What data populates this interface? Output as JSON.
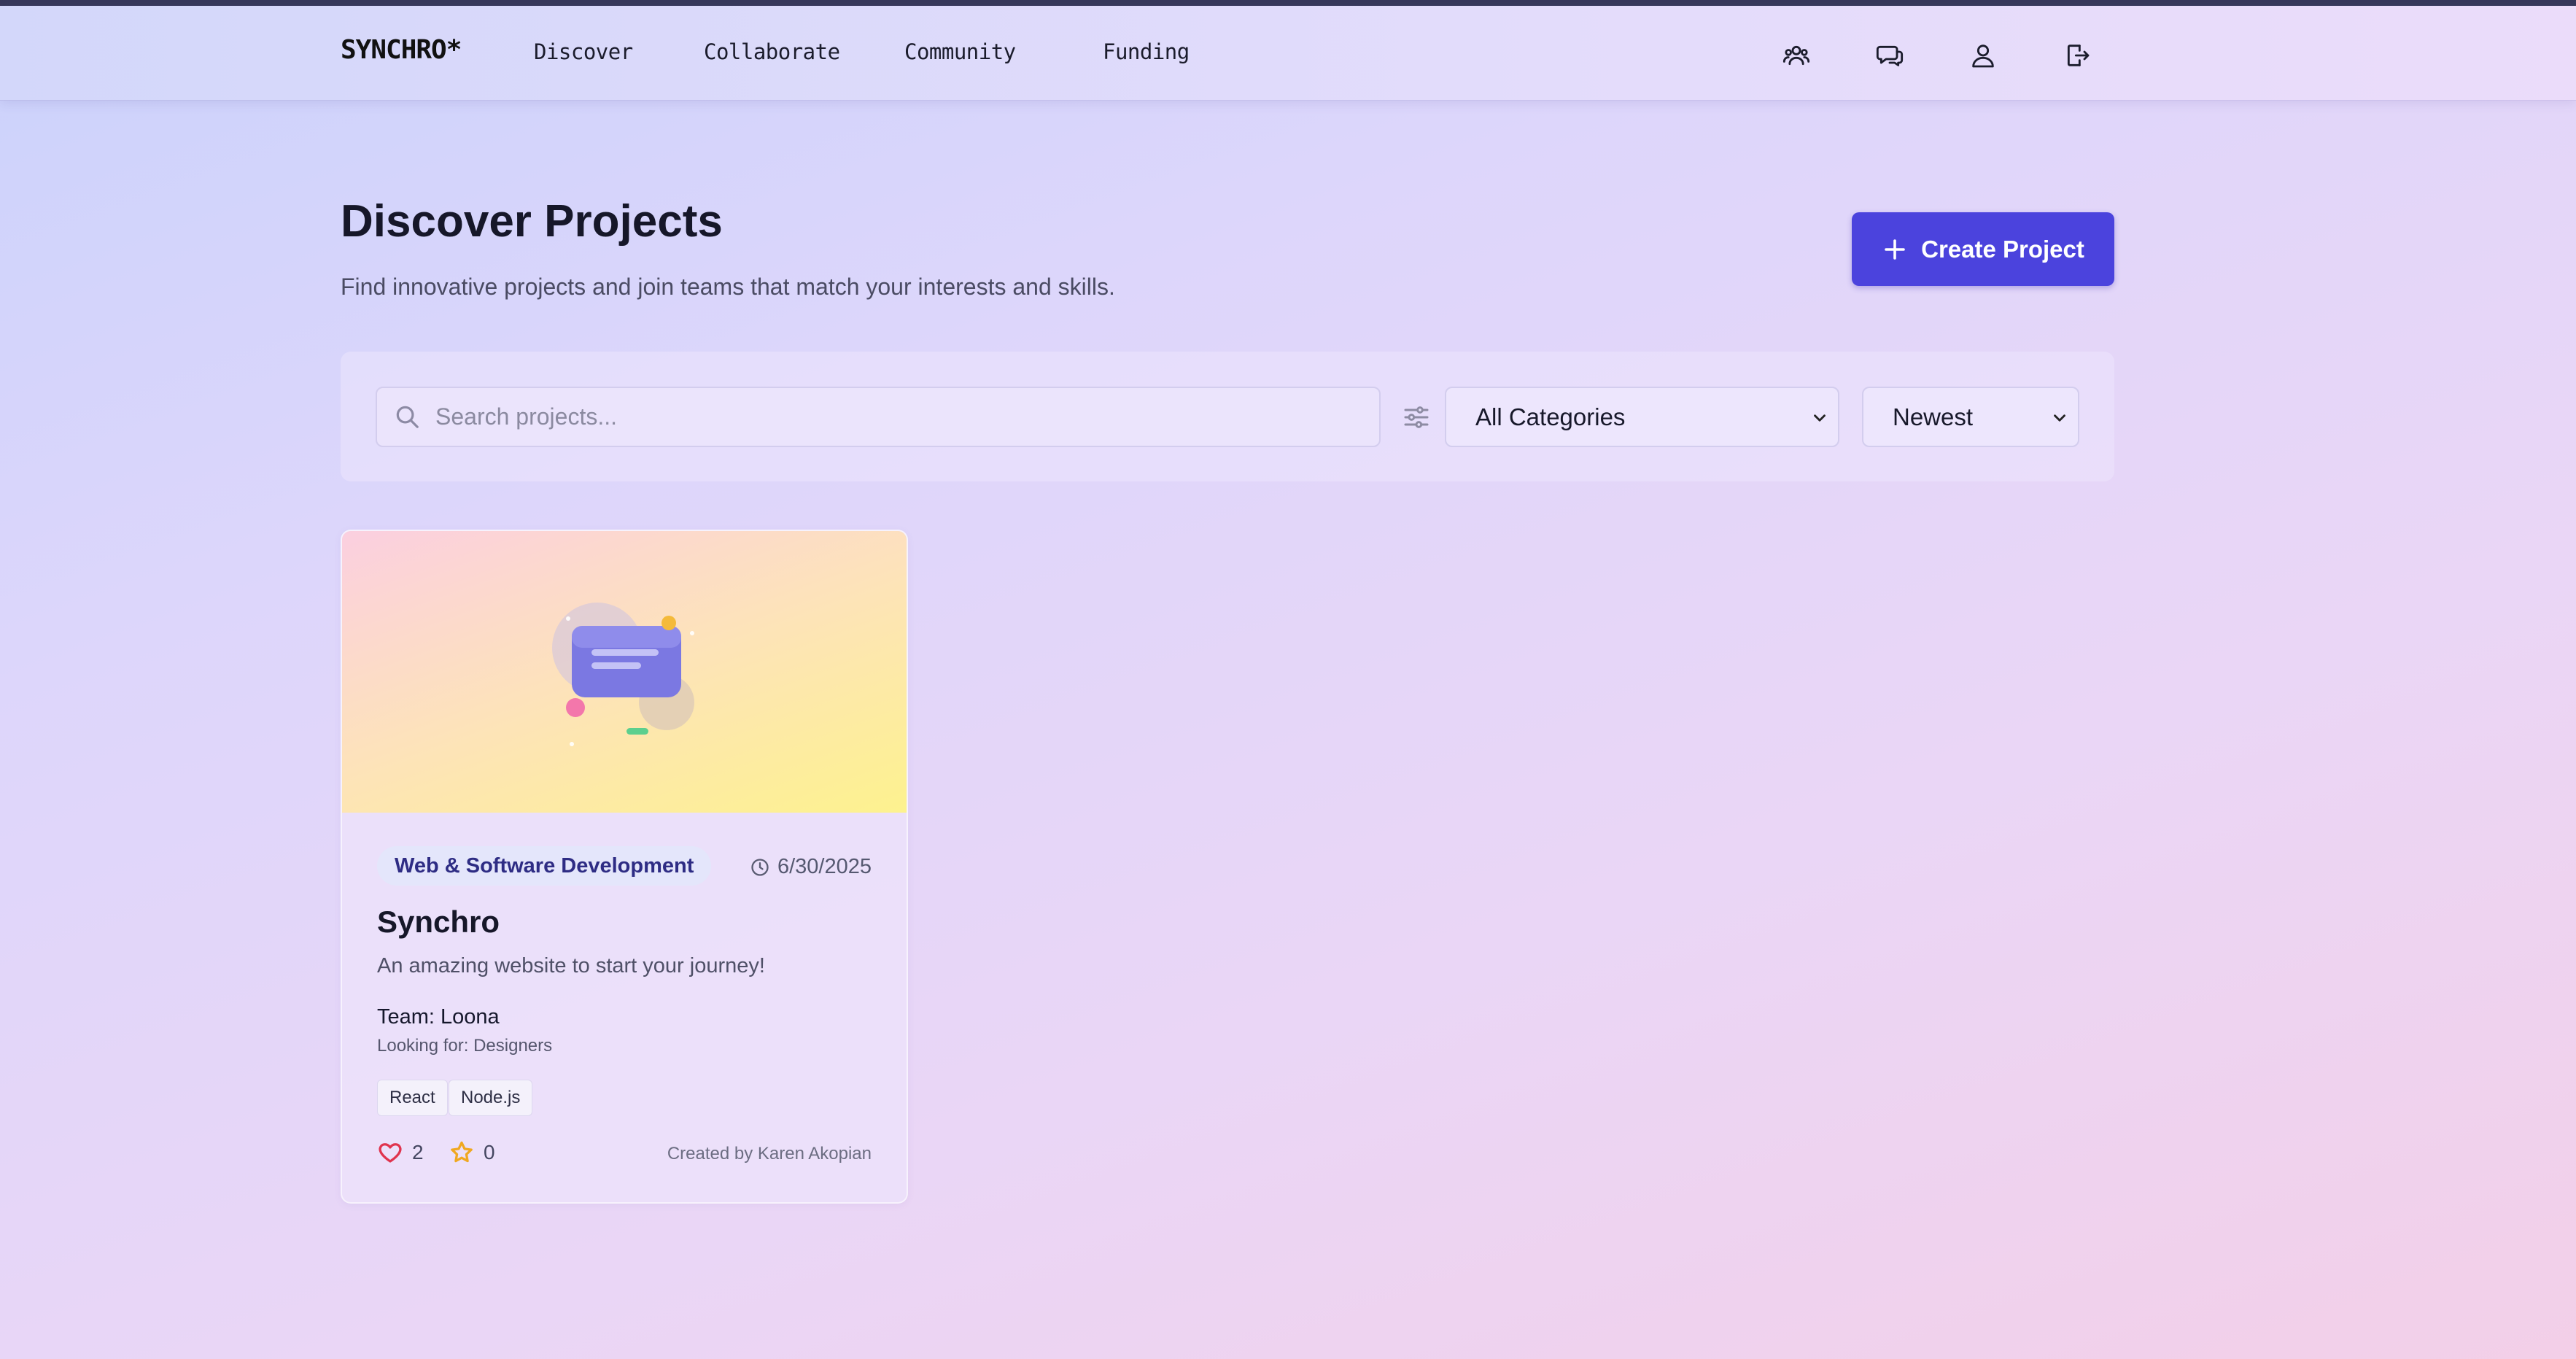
{
  "nav": {
    "logo": "SYNCHRO*",
    "links": [
      "Discover",
      "Collaborate",
      "Community",
      "Funding"
    ],
    "icons": [
      "users-icon",
      "chat-icon",
      "user-icon",
      "logout-icon"
    ]
  },
  "header": {
    "title": "Discover Projects",
    "subtitle": "Find innovative projects and join teams that match your interests and skills.",
    "create_button": "Create Project"
  },
  "filters": {
    "search_placeholder": "Search projects...",
    "category": "All Categories",
    "sort": "Newest"
  },
  "projects": [
    {
      "category": "Web & Software Development",
      "date": "6/30/2025",
      "title": "Synchro",
      "description": "An amazing website to start your journey!",
      "team": "Team: Loona",
      "looking_for": "Looking for: Designers",
      "tags": [
        "React",
        "Node.js"
      ],
      "likes": "2",
      "stars": "0",
      "created_by": "Created by Karen Akopian"
    }
  ],
  "colors": {
    "accent": "#4b43dd",
    "heart": "#e0344e",
    "star": "#f0a820"
  }
}
